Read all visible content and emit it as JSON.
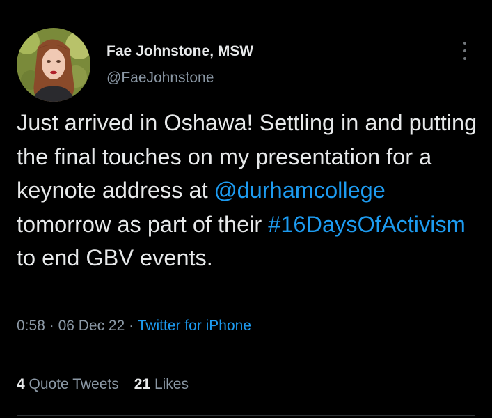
{
  "author": {
    "name": "Fae Johnstone, MSW",
    "handle": "@FaeJohnstone",
    "avatar_icon": "profile-photo"
  },
  "tweet": {
    "text_parts": [
      {
        "text": "Just arrived in Oshawa! Settling in and putting the final touches on my presentation for a keynote address at ",
        "type": "text"
      },
      {
        "text": "@durhamcollege",
        "type": "mention"
      },
      {
        "text": " tomorrow as part of their ",
        "type": "text"
      },
      {
        "text": "#16DaysOfActivism",
        "type": "hashtag"
      },
      {
        "text": " to end GBV events.",
        "type": "text"
      }
    ]
  },
  "meta": {
    "time": "0:58",
    "separator": "·",
    "date": "06 Dec 22",
    "source": "Twitter for iPhone"
  },
  "stats": {
    "quote_count": "4",
    "quote_label": "Quote Tweets",
    "likes_count": "21",
    "likes_label": "Likes"
  },
  "menu": {
    "icon": "more-options-icon"
  },
  "colors": {
    "background": "#000000",
    "text": "#e7e9ea",
    "secondary": "#8b98a5",
    "accent": "#1d9bf0",
    "divider": "#2f3336"
  }
}
